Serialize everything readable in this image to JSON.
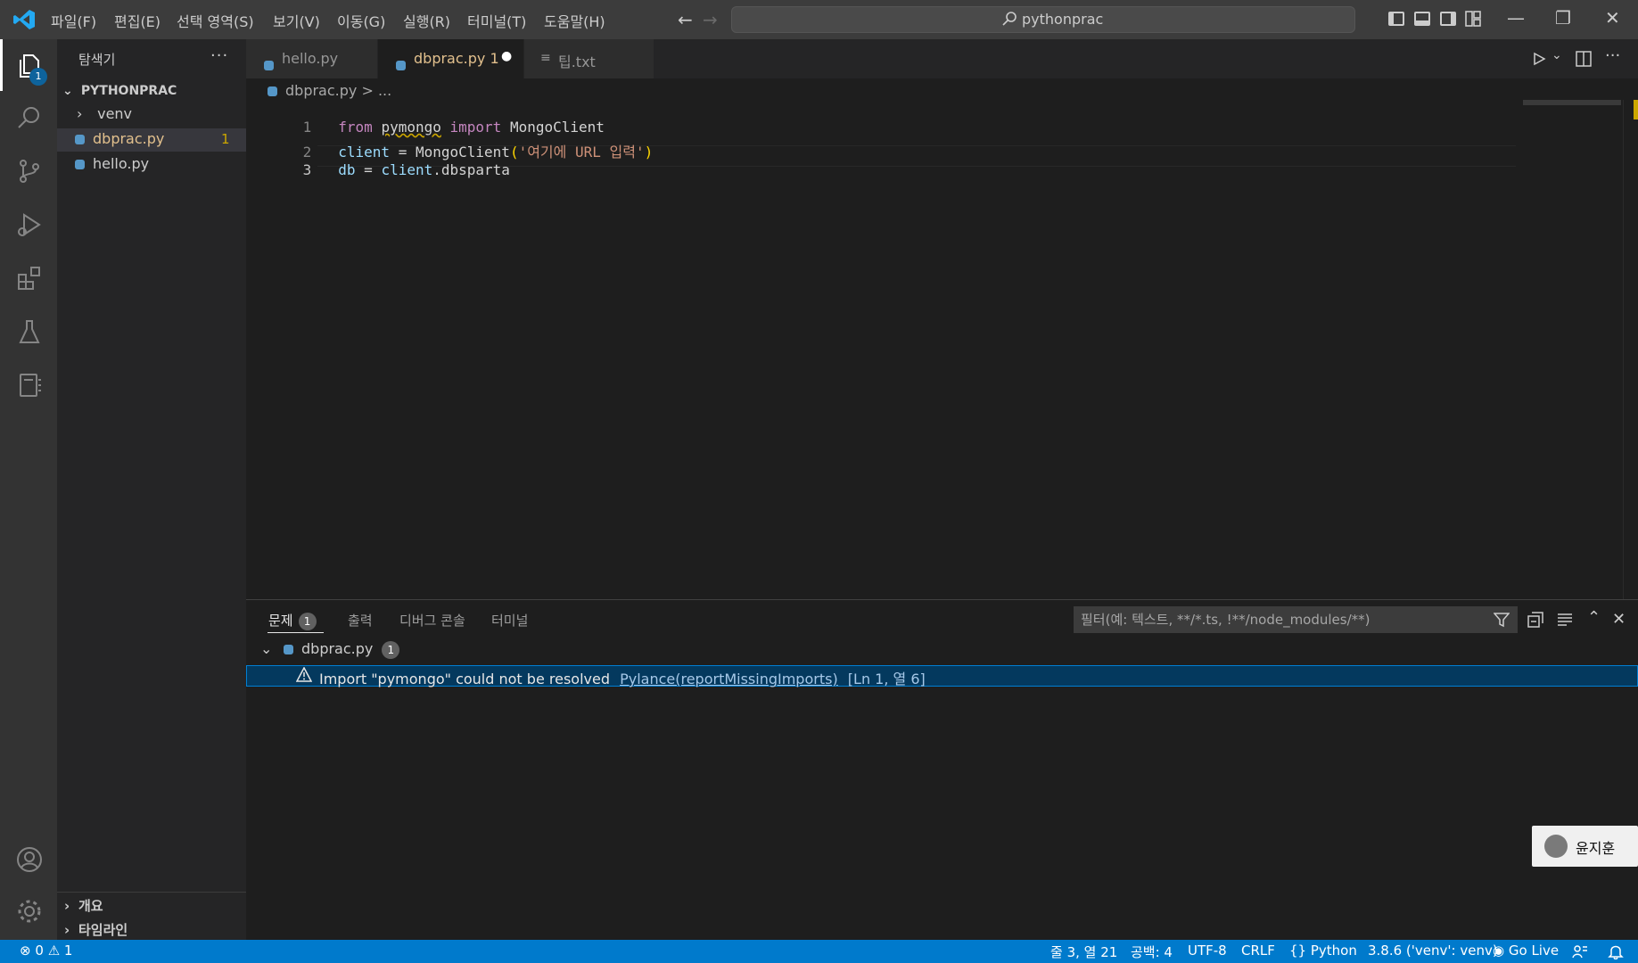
{
  "titlebar": {
    "menus": [
      "파일(F)",
      "편집(E)",
      "선택 영역(S)",
      "보기(V)",
      "이동(G)",
      "실행(R)",
      "터미널(T)",
      "도움말(H)"
    ],
    "search_text": "pythonprac"
  },
  "activitybar": {
    "explorer_badge": "1"
  },
  "sidebar": {
    "title": "탐색기",
    "more": "···",
    "folder": "PYTHONPRAC",
    "tree": [
      {
        "label": "venv",
        "type": "folder"
      },
      {
        "label": "dbprac.py",
        "type": "file",
        "badge": "1"
      },
      {
        "label": "hello.py",
        "type": "file"
      }
    ],
    "outline": "개요",
    "timeline": "타임라인"
  },
  "tabs": [
    {
      "label": "hello.py"
    },
    {
      "label": "dbprac.py 1"
    },
    {
      "label": "팁.txt"
    }
  ],
  "breadcrumb": {
    "file": "dbprac.py",
    "sep": ">",
    "rest": "..."
  },
  "editor": {
    "line_numbers": [
      "1",
      "2",
      "3"
    ],
    "line1": {
      "kw1": "from",
      "mod": "pymongo",
      "kw2": "import",
      "cls": "MongoClient"
    },
    "line2": {
      "var": "client",
      "eq": " = ",
      "cls": "MongoClient",
      "open": "(",
      "str": "'여기에 URL 입력'",
      "close": ")"
    },
    "line3": {
      "var1": "db",
      "eq": " = ",
      "var2": "client",
      "dot": ".",
      "attr": "dbsparta"
    }
  },
  "panel": {
    "tabs": [
      "문제",
      "출력",
      "디버그 콘솔",
      "터미널"
    ],
    "problems_count": "1",
    "filter_placeholder": "필터(예: 텍스트, **/*.ts, !**/node_modules/**)",
    "file": "dbprac.py",
    "file_count": "1",
    "problem_message": "Import \"pymongo\" could not be resolved",
    "problem_source": "Pylance(reportMissingImports)",
    "problem_location": "[Ln 1, 열 6]"
  },
  "toast": {
    "name": "윤지훈"
  },
  "statusbar": {
    "errors": "0",
    "warnings": "1",
    "cursor": "줄 3, 열 21",
    "spaces": "공백: 4",
    "encoding": "UTF-8",
    "eol": "CRLF",
    "language": "Python",
    "interpreter": "3.8.6 ('venv': venv)",
    "golive": "Go Live"
  },
  "colors": {
    "accent": "#007acc",
    "warning": "#cca700",
    "modified": "#e2c08d"
  }
}
